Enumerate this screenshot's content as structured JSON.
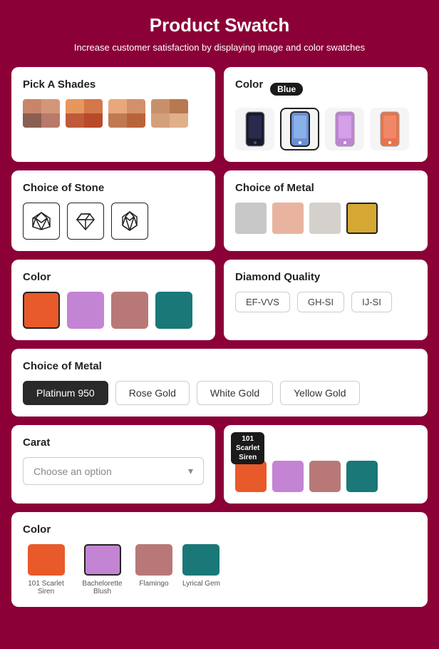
{
  "header": {
    "title": "Product Swatch",
    "subtitle": "Increase customer satisfaction by displaying image and color swatches"
  },
  "pickaShades": {
    "title": "Pick A Shades",
    "swatches": [
      {
        "id": 1,
        "colors": [
          "#c8856a",
          "#d4967a",
          "#8b5e52",
          "#b87a6a"
        ]
      },
      {
        "id": 2,
        "colors": [
          "#e8975c",
          "#d4784a",
          "#c05a3a",
          "#b84a2a"
        ]
      },
      {
        "id": 3,
        "colors": [
          "#e8a87c",
          "#d4906a",
          "#c07a52",
          "#b8643a"
        ]
      },
      {
        "id": 4,
        "colors": [
          "#c8906a",
          "#b87850",
          "#d4a07a",
          "#e0b08a"
        ]
      }
    ]
  },
  "colorPhone": {
    "title": "Color",
    "selectedBadge": "Blue",
    "phones": [
      {
        "id": 1,
        "color": "#1a1a2e",
        "selected": false
      },
      {
        "id": 2,
        "color": "#6b8fd4",
        "selected": true
      },
      {
        "id": 3,
        "color": "#c084d4",
        "selected": false
      },
      {
        "id": 4,
        "color": "#e8734a",
        "selected": false
      }
    ]
  },
  "choiceOfStone": {
    "title": "Choice of Stone",
    "options": [
      "diamond-outline",
      "diamond-gem",
      "diamond-facet"
    ]
  },
  "choiceOfMetalColor": {
    "title": "Choice of Metal",
    "swatches": [
      {
        "id": 1,
        "color": "#c8c8c8",
        "selected": false
      },
      {
        "id": 2,
        "color": "#e8b4a0",
        "selected": false
      },
      {
        "id": 3,
        "color": "#d4d0cc",
        "selected": false
      },
      {
        "id": 4,
        "color": "#d4a832",
        "selected": true
      }
    ]
  },
  "colorSection": {
    "title": "Color",
    "colors": [
      {
        "id": 1,
        "color": "#e85a2a",
        "selected": true
      },
      {
        "id": 2,
        "color": "#c484d4",
        "selected": false
      },
      {
        "id": 3,
        "color": "#b87878",
        "selected": false
      },
      {
        "id": 4,
        "color": "#1a7878",
        "selected": false
      }
    ]
  },
  "diamondQuality": {
    "title": "Diamond Quality",
    "options": [
      "EF-VVS",
      "GH-SI",
      "IJ-SI"
    ]
  },
  "choiceOfMetal": {
    "title": "Choice of Metal",
    "options": [
      {
        "label": "Platinum 950",
        "selected": true
      },
      {
        "label": "Rose Gold",
        "selected": false
      },
      {
        "label": "White Gold",
        "selected": false
      },
      {
        "label": "Yellow Gold",
        "selected": false
      }
    ]
  },
  "carat": {
    "title": "Carat",
    "placeholder": "Choose an option",
    "badge": {
      "line1": "101",
      "line2": "Scarlet",
      "line3": "Siren"
    },
    "swatches": [
      {
        "color": "#e85a2a"
      },
      {
        "color": "#c484d4"
      },
      {
        "color": "#b87878"
      },
      {
        "color": "#1a7878"
      }
    ]
  },
  "bottomColor": {
    "title": "Color",
    "options": [
      {
        "label": "101 Scarlet Siren",
        "color": "#e85a2a",
        "selected": false
      },
      {
        "label": "Bachelorette Blush",
        "color": "#c484d4",
        "selected": true
      },
      {
        "label": "Flamingo",
        "color": "#b87878",
        "selected": false
      },
      {
        "label": "Lyrical Gem",
        "color": "#1a7878",
        "selected": false
      }
    ]
  }
}
